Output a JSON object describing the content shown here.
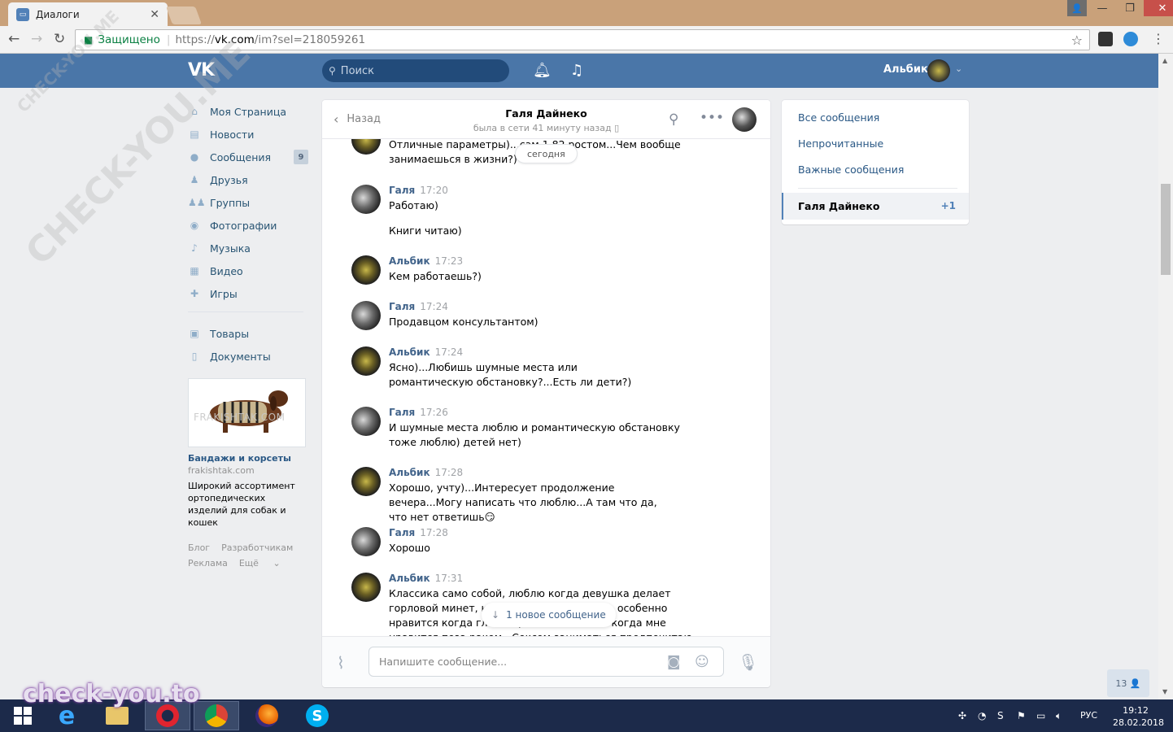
{
  "browser": {
    "tab_title": "Диалоги",
    "secure_label": "Защищено",
    "url_prefix": "https://",
    "url_host": "vk.com",
    "url_path": "/im?sel=218059261"
  },
  "header": {
    "search_placeholder": "Поиск",
    "user_name": "Альбик"
  },
  "left_menu": {
    "items": [
      {
        "label": "Моя Страница",
        "icon": "home-icon"
      },
      {
        "label": "Новости",
        "icon": "news-icon"
      },
      {
        "label": "Сообщения",
        "icon": "messages-icon",
        "badge": "9"
      },
      {
        "label": "Друзья",
        "icon": "friends-icon"
      },
      {
        "label": "Группы",
        "icon": "groups-icon"
      },
      {
        "label": "Фотографии",
        "icon": "camera-icon"
      },
      {
        "label": "Музыка",
        "icon": "music-icon"
      },
      {
        "label": "Видео",
        "icon": "video-icon"
      },
      {
        "label": "Игры",
        "icon": "games-icon"
      }
    ],
    "items2": [
      {
        "label": "Товары",
        "icon": "bag-icon"
      },
      {
        "label": "Документы",
        "icon": "document-icon"
      }
    ]
  },
  "ad": {
    "watermark": "FRAKISHTAK.COM",
    "title": "Бандажи и корсеты",
    "domain": "frakishtak.com",
    "description": "Широкий ассортимент ортопедических изделий для собак и кошек"
  },
  "footer": {
    "blog": "Блог",
    "developers": "Разработчикам",
    "ads": "Реклама",
    "more": "Ещё"
  },
  "dialog": {
    "back_label": "Назад",
    "peer_name": "Галя Дайнеко",
    "peer_status": "была в сети 41 минуту назад",
    "date_label": "сегодня",
    "new_message_label": "1 новое сообщение",
    "input_placeholder": "Напишите сообщение...",
    "messages": [
      {
        "author": "",
        "time": "",
        "text": "Отличные параметры)...сам 1.82 ростом...Чем вообще занимаешься в жизни?)",
        "who": "alb"
      },
      {
        "author": "Галя",
        "time": "17:20",
        "text": "Работаю)",
        "who": "gal"
      },
      {
        "author": "",
        "time": "",
        "text": "Книги читаю)",
        "who": "gal"
      },
      {
        "author": "Альбик",
        "time": "17:23",
        "text": "Кем работаешь?)",
        "who": "alb"
      },
      {
        "author": "Галя",
        "time": "17:24",
        "text": "Продавцом консультантом)",
        "who": "gal"
      },
      {
        "author": "Альбик",
        "time": "17:24",
        "text": "Ясно)...Любишь шумные места или романтическую обстановку?...Есть ли дети?)",
        "who": "alb"
      },
      {
        "author": "Галя",
        "time": "17:26",
        "text": "И шумные места люблю и романтическую обстановку тоже люблю) детей нет)",
        "who": "gal"
      },
      {
        "author": "Альбик",
        "time": "17:28",
        "text": "Хорошо, учту)...Интересует продолжение вечера...Могу написать что люблю...А там что да, что нет ответишь😏",
        "who": "alb"
      },
      {
        "author": "Галя",
        "time": "17:28",
        "text": "Хорошо",
        "who": "gal"
      },
      {
        "author": "Альбик",
        "time": "17:31",
        "text": "Классика само собой, люблю когда девушка делает горловой минет, кончать в рот и на лицо, особенно нравится когда глотает)...Люблю анал и когда мне нравится поза раком...Сексом заниматься предпочитаю",
        "who": "alb"
      }
    ]
  },
  "right_panel": {
    "all": "Все сообщения",
    "unread": "Непрочитанные",
    "important": "Важные сообщения",
    "active_name": "Галя Дайнеко",
    "active_count": "+1"
  },
  "online_count": "13",
  "taskbar": {
    "lang": "РУС",
    "time": "19:12",
    "date": "28.02.2018"
  },
  "watermarks": {
    "main": "CHECK-YOU.ME",
    "brand": "check-you.to"
  }
}
